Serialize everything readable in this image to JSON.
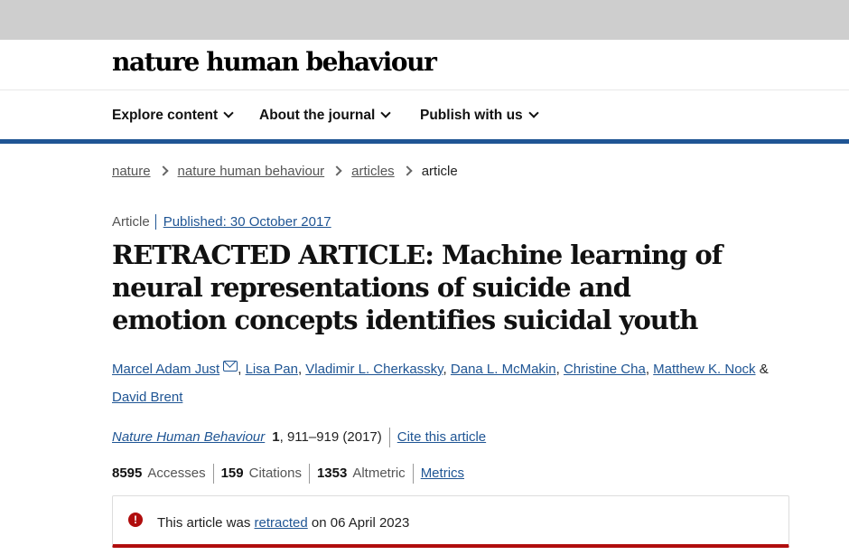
{
  "brand": {
    "logo": "nature human behaviour"
  },
  "nav": {
    "items": [
      {
        "label": "Explore content"
      },
      {
        "label": "About the journal"
      },
      {
        "label": "Publish with us"
      }
    ]
  },
  "breadcrumb": {
    "items": [
      "nature",
      "nature human behaviour",
      "articles"
    ],
    "current": "article"
  },
  "article": {
    "type": "Article",
    "published": "Published: 30 October 2017",
    "title": "RETRACTED ARTICLE: Machine learning of neural representations of suicide and emotion concepts identifies suicidal youth",
    "authors": [
      "Marcel Adam Just",
      "Lisa Pan",
      "Vladimir L. Cherkassky",
      "Dana L. McMakin",
      "Christine Cha",
      "Matthew K. Nock",
      "David Brent"
    ],
    "journal": "Nature Human Behaviour",
    "volume": "1",
    "pages": ", 911–919 (2017)",
    "cite_label": "Cite this article"
  },
  "metrics": {
    "accesses_value": "8595",
    "accesses_label": "Accesses",
    "citations_value": "159",
    "citations_label": "Citations",
    "altmetric_value": "1353",
    "altmetric_label": "Altmetric",
    "link_label": "Metrics"
  },
  "notice": {
    "text_before": "This article was",
    "link": "retracted",
    "text_after": "on 06 April 2023"
  },
  "colors": {
    "link": "#1f5594",
    "accent_bar": "#1f5594",
    "alert": "#b00d0d"
  }
}
